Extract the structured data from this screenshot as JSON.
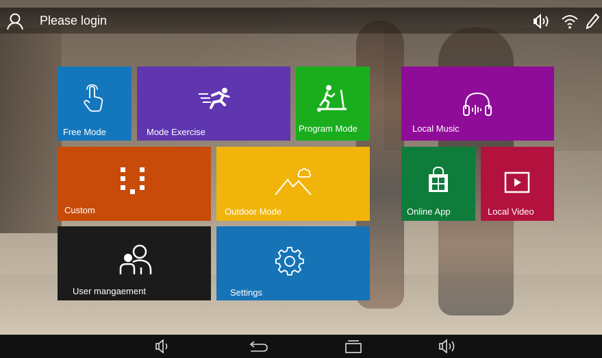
{
  "status_bar": {
    "login_text": "Please login",
    "icons": [
      "user-icon",
      "volume-icon",
      "wifi-icon",
      "pen-icon"
    ]
  },
  "tiles": {
    "free_mode": {
      "label": "Free Mode",
      "icon": "hand-pointer-icon",
      "color": "#1477bd"
    },
    "mode_exercise": {
      "label": "Mode Exercise",
      "icon": "runner-icon",
      "color": "#5f36b0"
    },
    "program_mode": {
      "label": "Program Mode",
      "icon": "treadmill-icon",
      "color": "#1aae1f"
    },
    "local_music": {
      "label": "Local Music",
      "icon": "headphones-icon",
      "color": "#8f0c98"
    },
    "custom": {
      "label": "Custom",
      "icon": "grid-dots-icon",
      "color": "#c84b0a"
    },
    "outdoor_mode": {
      "label": "Outdoor Mode",
      "icon": "mountain-icon",
      "color": "#f1b40b"
    },
    "online_app": {
      "label": "Online App",
      "icon": "store-icon",
      "color": "#0e7c3a"
    },
    "local_video": {
      "label": "Local Video",
      "icon": "play-icon",
      "color": "#b3123f"
    },
    "user_management": {
      "label": "User mangaement",
      "icon": "users-icon",
      "color": "#1b1b1b"
    },
    "settings": {
      "label": "Settings",
      "icon": "gear-icon",
      "color": "#1673b6"
    }
  },
  "nav_bar": {
    "buttons": [
      "volume-down-icon",
      "back-icon",
      "recents-icon",
      "volume-up-icon"
    ]
  }
}
